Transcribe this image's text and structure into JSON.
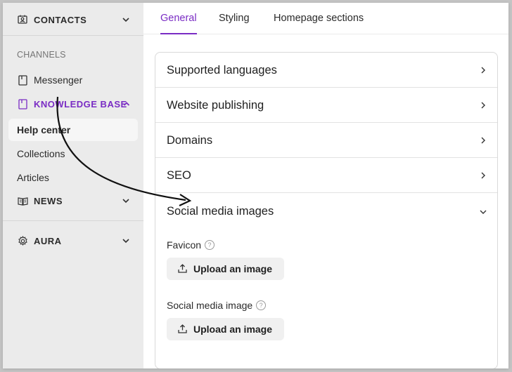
{
  "sidebar": {
    "contacts_label": "CONTACTS",
    "channels_label": "CHANNELS",
    "messenger_label": "Messenger",
    "knowledge_base_label": "KNOWLEDGE BASE",
    "kb_items": [
      "Help center",
      "Collections",
      "Articles"
    ],
    "news_label": "NEWS",
    "aura_label": "AURA",
    "accent_color": "#7a2cc4"
  },
  "tabs": [
    "General",
    "Styling",
    "Homepage sections"
  ],
  "accordion": [
    "Supported languages",
    "Website publishing",
    "Domains",
    "SEO",
    "Social media images"
  ],
  "social_media": {
    "favicon_label": "Favicon",
    "social_image_label": "Social media image",
    "upload_label": "Upload an image"
  }
}
